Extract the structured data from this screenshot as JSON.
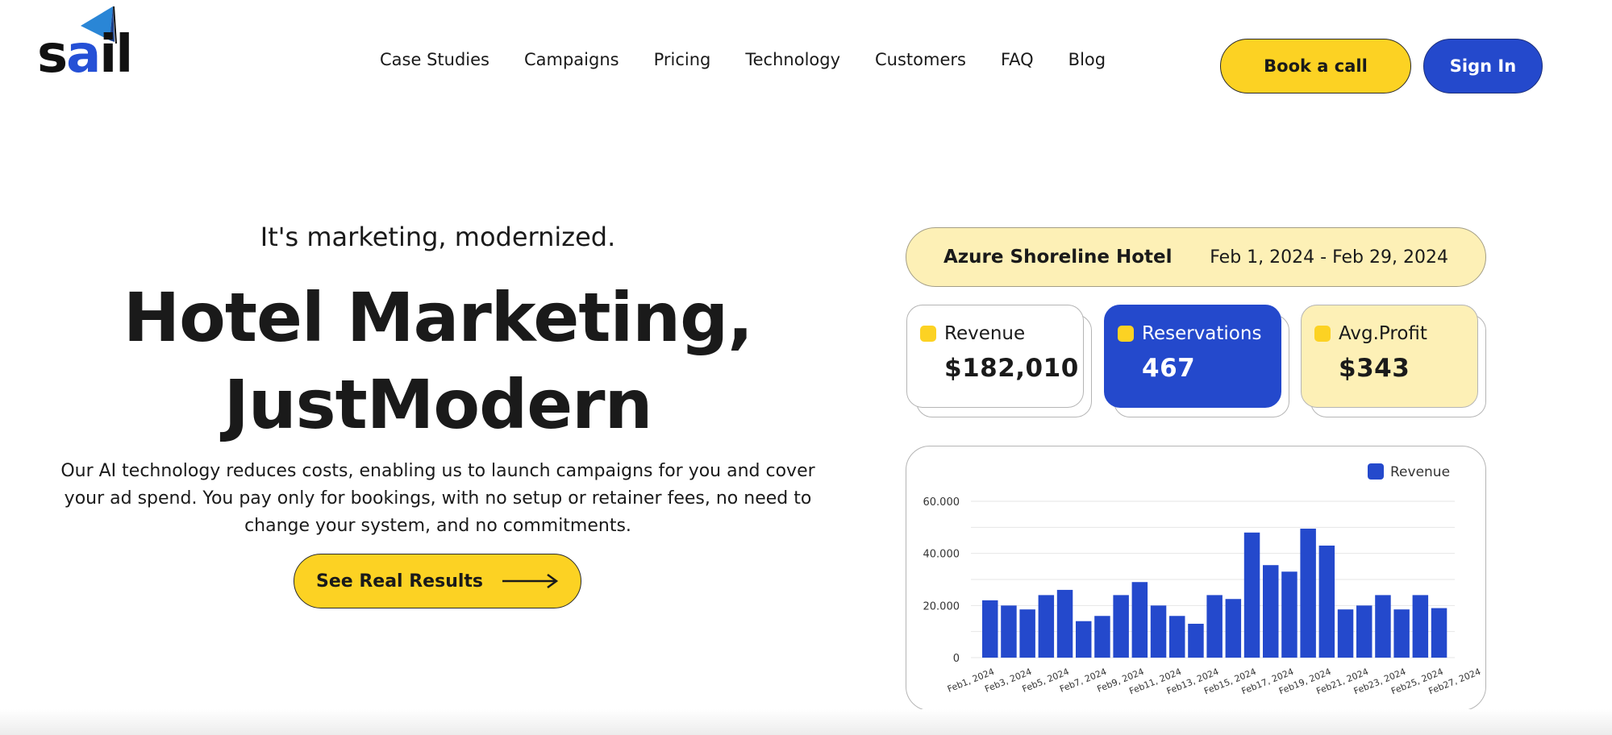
{
  "brand": {
    "name": "sail",
    "name_pre": "s",
    "name_accent": "a",
    "name_post": "il",
    "accent_color": "#2550d6"
  },
  "nav": {
    "items": [
      "Case Studies",
      "Campaigns",
      "Pricing",
      "Technology",
      "Customers",
      "FAQ",
      "Blog"
    ]
  },
  "header": {
    "book_label": "Book a call",
    "signin_label": "Sign In"
  },
  "hero": {
    "tagline": "It's marketing, modernized.",
    "headline_line1": "Hotel Marketing,",
    "headline_line2": "JustModern",
    "description": "Our AI technology reduces costs, enabling us to launch campaigns for you and cover your ad spend. You pay only for bookings, with no setup or retainer fees, no need to change your system, and no commitments.",
    "cta_label": "See Real Results"
  },
  "dashboard": {
    "hotel_name": "Azure Shoreline Hotel",
    "date_range": "Feb 1, 2024 - Feb 29, 2024",
    "cards": [
      {
        "label": "Revenue",
        "value": "$182,010"
      },
      {
        "label": "Reservations",
        "value": "467"
      },
      {
        "label": "Avg.Profit",
        "value": "$343"
      }
    ]
  },
  "colors": {
    "yellow": "#fcd223",
    "light_yellow": "#fdf0b6",
    "blue": "#2449cc"
  },
  "chart_data": {
    "type": "bar",
    "legend": [
      "Revenue"
    ],
    "legend_position": "top-right",
    "grid": true,
    "ylim": [
      0,
      60000
    ],
    "y_ticks": [
      "0",
      "20.000",
      "40.000",
      "60.000"
    ],
    "x_tick_labels": [
      "Feb1, 2024",
      "Feb3, 2024",
      "Feb5, 2024",
      "Feb7, 2024",
      "Feb9, 2024",
      "Feb11, 2024",
      "Feb13, 2024",
      "Feb15, 2024",
      "Feb17, 2024",
      "Feb19, 2024",
      "Feb21, 2024",
      "Feb23, 2024",
      "Feb25, 2024",
      "Feb27, 2024"
    ],
    "series": [
      {
        "name": "Revenue",
        "color": "#2449cc",
        "values": [
          22000,
          20000,
          18500,
          24000,
          26000,
          14000,
          16000,
          24000,
          29000,
          20000,
          16000,
          13000,
          24000,
          22500,
          48000,
          35500,
          33000,
          49500,
          43000,
          18500,
          20000,
          24000,
          18500,
          24000,
          19000
        ]
      }
    ]
  }
}
